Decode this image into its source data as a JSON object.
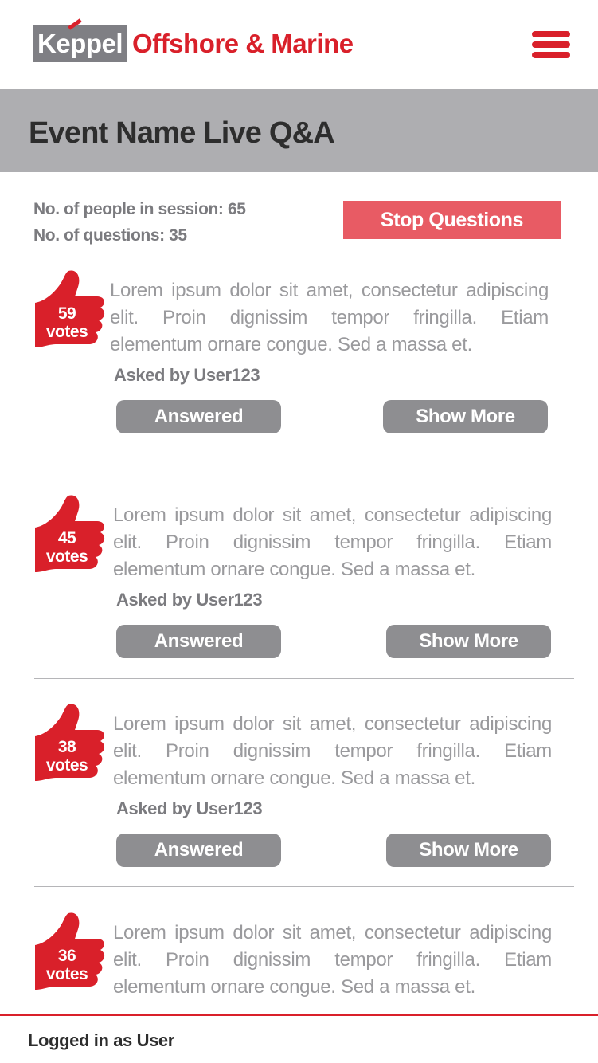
{
  "header": {
    "logo_brand": "Keppel",
    "logo_name": "Offshore & Marine",
    "menu_icon": "hamburger-menu-icon"
  },
  "title": "Event Name Live Q&A",
  "stats": {
    "people": "No. of people in session: 65",
    "questions": "No. of questions: 35"
  },
  "stop_button": "Stop Questions",
  "questions": [
    {
      "votes": "59",
      "votes_label": "votes",
      "text": "Lorem ipsum dolor sit amet, consectetur adipiscing elit. Proin dignissim tempor fringilla. Etiam elementum ornare congue. Sed a massa et.",
      "asker": "Asked by User123",
      "answered_label": "Answered",
      "show_more_label": "Show More"
    },
    {
      "votes": "45",
      "votes_label": "votes",
      "text": "Lorem ipsum dolor sit amet, consectetur adipiscing elit. Proin dignissim tempor fringilla. Etiam elementum ornare congue. Sed a massa et.",
      "asker": "Asked by User123",
      "answered_label": "Answered",
      "show_more_label": "Show More"
    },
    {
      "votes": "38",
      "votes_label": "votes",
      "text": "Lorem ipsum dolor sit amet, consectetur adipiscing elit. Proin dignissim tempor fringilla. Etiam elementum ornare congue. Sed a massa et.",
      "asker": "Asked by User123",
      "answered_label": "Answered",
      "show_more_label": "Show More"
    },
    {
      "votes": "36",
      "votes_label": "votes",
      "text": "Lorem ipsum dolor sit amet, consectetur adipiscing elit. Proin dignissim tempor fringilla. Etiam elementum ornare congue. Sed a massa et."
    }
  ],
  "footer": {
    "logged_in": "Logged in as User"
  },
  "colors": {
    "brand_red": "#d9202a",
    "stop_button": "#e85b64",
    "title_bar": "#aeaeb1",
    "button_gray": "#8e8e91"
  }
}
